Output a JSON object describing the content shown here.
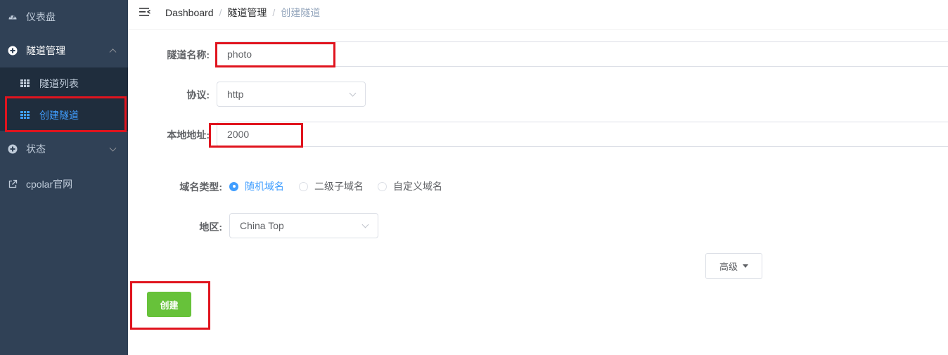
{
  "sidebar": {
    "items": [
      {
        "label": "仪表盘",
        "icon": "dashboard-icon"
      },
      {
        "label": "隧道管理",
        "icon": "plus-circle-icon",
        "expanded": true
      },
      {
        "label": "状态",
        "icon": "plus-circle-icon",
        "expanded": false
      },
      {
        "label": "cpolar官网",
        "icon": "external-link-icon"
      }
    ],
    "submenu": [
      {
        "label": "隧道列表",
        "icon": "table-icon"
      },
      {
        "label": "创建隧道",
        "icon": "table-icon",
        "active": true
      }
    ]
  },
  "breadcrumb": {
    "items": [
      "Dashboard",
      "隧道管理"
    ],
    "current": "创建隧道",
    "separator": "/"
  },
  "form": {
    "name_label": "隧道名称:",
    "name_value": "photo",
    "protocol_label": "协议:",
    "protocol_value": "http",
    "local_label": "本地地址:",
    "local_value": "2000",
    "domain_type_label": "域名类型:",
    "domain_types": [
      "随机域名",
      "二级子域名",
      "自定义域名"
    ],
    "domain_type_selected": "随机域名",
    "region_label": "地区:",
    "region_value": "China Top",
    "advanced_label": "高级",
    "create_label": "创建"
  },
  "colors": {
    "sidebar_bg": "#304156",
    "submenu_bg": "#1f2d3d",
    "accent": "#409eff",
    "create_button": "#67c23a",
    "highlight_box": "#e0141e"
  }
}
